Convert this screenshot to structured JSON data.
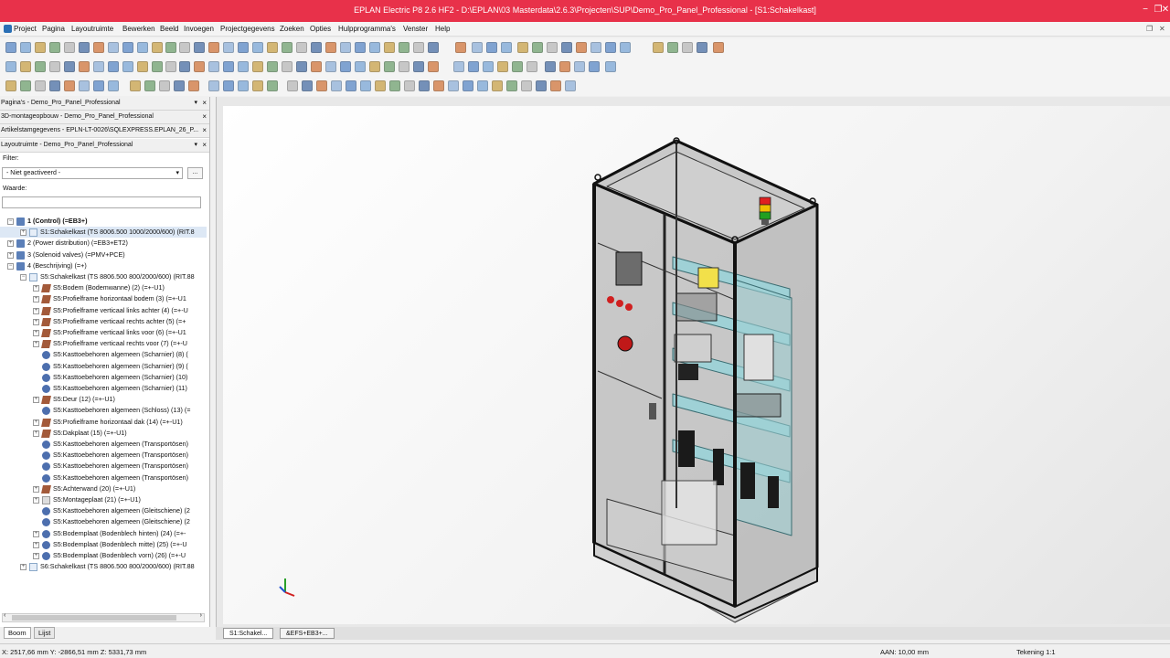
{
  "window": {
    "title": "EPLAN Electric P8 2.6 HF2 - D:\\EPLAN\\03 Masterdata\\2.6.3\\Projecten\\SUP\\Demo_Pro_Panel_Professional - [S1:Schakelkast]",
    "accent_color": "#e8314a",
    "controls": [
      "minimize-icon",
      "restore-icon",
      "close-icon"
    ]
  },
  "menu": [
    "Project",
    "Pagina",
    "Layoutruimte",
    "Bewerken",
    "Beeld",
    "Invoegen",
    "Projectgegevens",
    "Zoeken",
    "Opties",
    "Hulpprogramma's",
    "Venster",
    "Help"
  ],
  "panels": {
    "pages": "Pagina's - Demo_Pro_Panel_Professional",
    "assembly3d": "3D-montageopbouw - Demo_Pro_Panel_Professional",
    "articles": "Artikelstamgegevens - EPLN-LT-0026\\SQLEXPRESS.EPLAN_26_P...",
    "layout": "Layoutruimte - Demo_Pro_Panel_Professional"
  },
  "filter": {
    "label": "Filter:",
    "value": "- Niet geactiveerd -",
    "button": "...",
    "waarde_label": "Waarde:",
    "waarde_value": ""
  },
  "tree": [
    {
      "label": "1 (Control) (=EB3+)",
      "level": 0,
      "expander": "−",
      "icon": "grp",
      "bold": true
    },
    {
      "label": "S1:Schakelkast (TS 8006.500 1000/2000/600) (RIT.8",
      "level": 1,
      "expander": "+",
      "icon": "page",
      "selected": true
    },
    {
      "label": "2 (Power distribution) (=EB3+ET2)",
      "level": 0,
      "expander": "+",
      "icon": "grp"
    },
    {
      "label": "3 (Solenoid valves) (=PMV+PCE)",
      "level": 0,
      "expander": "+",
      "icon": "grp"
    },
    {
      "label": "4 (Beschrijving) (=+)",
      "level": 0,
      "expander": "−",
      "icon": "grp"
    },
    {
      "label": "S5:Schakelkast (TS 8806.500 800/2000/600) (RIT.88",
      "level": 1,
      "expander": "−",
      "icon": "page"
    },
    {
      "label": "S5:Bodem (Bodemwanne) (2) (=+-U1)",
      "level": 2,
      "expander": "+",
      "icon": "part"
    },
    {
      "label": "S5:Profielframe horizontaal bodem (3) (=+-U1",
      "level": 2,
      "expander": "+",
      "icon": "part"
    },
    {
      "label": "S5:Profielframe verticaal links achter (4) (=+-U",
      "level": 2,
      "expander": "+",
      "icon": "part"
    },
    {
      "label": "S5:Profielframe verticaal rechts achter (5) (=+",
      "level": 2,
      "expander": "+",
      "icon": "part"
    },
    {
      "label": "S5:Profielframe verticaal links voor (6) (=+-U1",
      "level": 2,
      "expander": "+",
      "icon": "part"
    },
    {
      "label": "S5:Profielframe verticaal rechts voor (7) (=+-U",
      "level": 2,
      "expander": "+",
      "icon": "part"
    },
    {
      "label": "S5:Kasttoebehoren algemeen (Scharnier) (8) (",
      "level": 2,
      "expander": "",
      "icon": "acc"
    },
    {
      "label": "S5:Kasttoebehoren algemeen (Scharnier) (9) (",
      "level": 2,
      "expander": "",
      "icon": "acc"
    },
    {
      "label": "S5:Kasttoebehoren algemeen (Scharnier) (10)",
      "level": 2,
      "expander": "",
      "icon": "acc"
    },
    {
      "label": "S5:Kasttoebehoren algemeen (Scharnier) (11)",
      "level": 2,
      "expander": "",
      "icon": "acc"
    },
    {
      "label": "S5:Deur (12) (=+-U1)",
      "level": 2,
      "expander": "+",
      "icon": "part"
    },
    {
      "label": "S5:Kasttoebehoren algemeen (Schloss) (13) (=",
      "level": 2,
      "expander": "",
      "icon": "acc"
    },
    {
      "label": "S5:Profielframe horizontaal dak (14) (=+-U1)",
      "level": 2,
      "expander": "+",
      "icon": "part"
    },
    {
      "label": "S5:Dakplaat (15) (=+-U1)",
      "level": 2,
      "expander": "+",
      "icon": "part"
    },
    {
      "label": "S5:Kasttoebehoren algemeen (Transportösen)",
      "level": 2,
      "expander": "",
      "icon": "acc"
    },
    {
      "label": "S5:Kasttoebehoren algemeen (Transportösen)",
      "level": 2,
      "expander": "",
      "icon": "acc"
    },
    {
      "label": "S5:Kasttoebehoren algemeen (Transportösen)",
      "level": 2,
      "expander": "",
      "icon": "acc"
    },
    {
      "label": "S5:Kasttoebehoren algemeen (Transportösen)",
      "level": 2,
      "expander": "",
      "icon": "acc"
    },
    {
      "label": "S5:Achterwand (20) (=+-U1)",
      "level": 2,
      "expander": "+",
      "icon": "part"
    },
    {
      "label": "S5:Montageplaat (21) (=+-U1)",
      "level": 2,
      "expander": "+",
      "icon": "plate"
    },
    {
      "label": "S5:Kasttoebehoren algemeen (Gleitschiene) (2",
      "level": 2,
      "expander": "",
      "icon": "acc"
    },
    {
      "label": "S5:Kasttoebehoren algemeen (Gleitschiene) (2",
      "level": 2,
      "expander": "",
      "icon": "acc"
    },
    {
      "label": "S5:Bodemplaat (Bodenblech hinten) (24) (=+-",
      "level": 2,
      "expander": "+",
      "icon": "acc"
    },
    {
      "label": "S5:Bodemplaat (Bodenblech mitte) (25) (=+-U",
      "level": 2,
      "expander": "+",
      "icon": "acc"
    },
    {
      "label": "S5:Bodemplaat (Bodenblech vorn) (26) (=+-U",
      "level": 2,
      "expander": "+",
      "icon": "acc"
    },
    {
      "label": "S6:Schakelkast (TS 8806.500 800/2000/600) (RIT.88",
      "level": 1,
      "expander": "+",
      "icon": "page"
    }
  ],
  "left_tabs": [
    "Boom",
    "Lijst"
  ],
  "doc_tabs": [
    "S1:Schakel...",
    "&EFS+EB3+..."
  ],
  "status": {
    "coords": "X: 2517,66 mm    Y: -2866,51 mm    Z: 5331,73 mm",
    "aan": "AAN: 10,00 mm",
    "tekening": "Tekening 1:1"
  },
  "viewport": {
    "signal_tower_colors": [
      "#e02020",
      "#f0c000",
      "#20a020"
    ],
    "rail_color": "#9fd1d6",
    "axes": [
      "x",
      "y",
      "z"
    ]
  }
}
